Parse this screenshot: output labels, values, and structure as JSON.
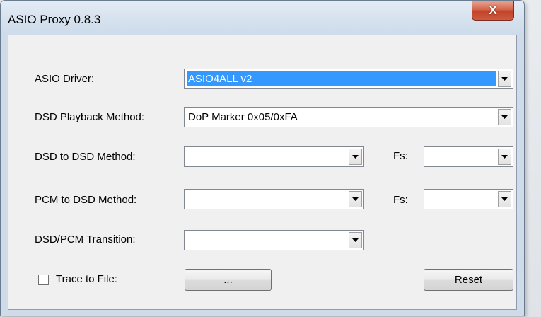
{
  "window": {
    "title": "ASIO Proxy 0.8.3",
    "close_glyph": "X"
  },
  "form": {
    "asio_driver": {
      "label": "ASIO Driver:",
      "value": "ASIO4ALL v2"
    },
    "dsd_playback": {
      "label": "DSD Playback Method:",
      "value": "DoP Marker 0x05/0xFA"
    },
    "dsd_to_dsd": {
      "label": "DSD to DSD Method:",
      "value": "",
      "fs_label": "Fs:",
      "fs_value": ""
    },
    "pcm_to_dsd": {
      "label": "PCM to DSD Method:",
      "value": "",
      "fs_label": "Fs:",
      "fs_value": ""
    },
    "transition": {
      "label": "DSD/PCM Transition:",
      "value": ""
    },
    "trace": {
      "label": "Trace to File:",
      "checked": false,
      "browse_label": "..."
    },
    "reset_label": "Reset"
  },
  "icons": {
    "dropdown": "chevron-down-icon",
    "close": "close-icon",
    "checkbox": "checkbox-icon"
  },
  "colors": {
    "selection": "#3399ff",
    "close_button": "#c2432a",
    "titlebar": "#d5e1ee"
  }
}
